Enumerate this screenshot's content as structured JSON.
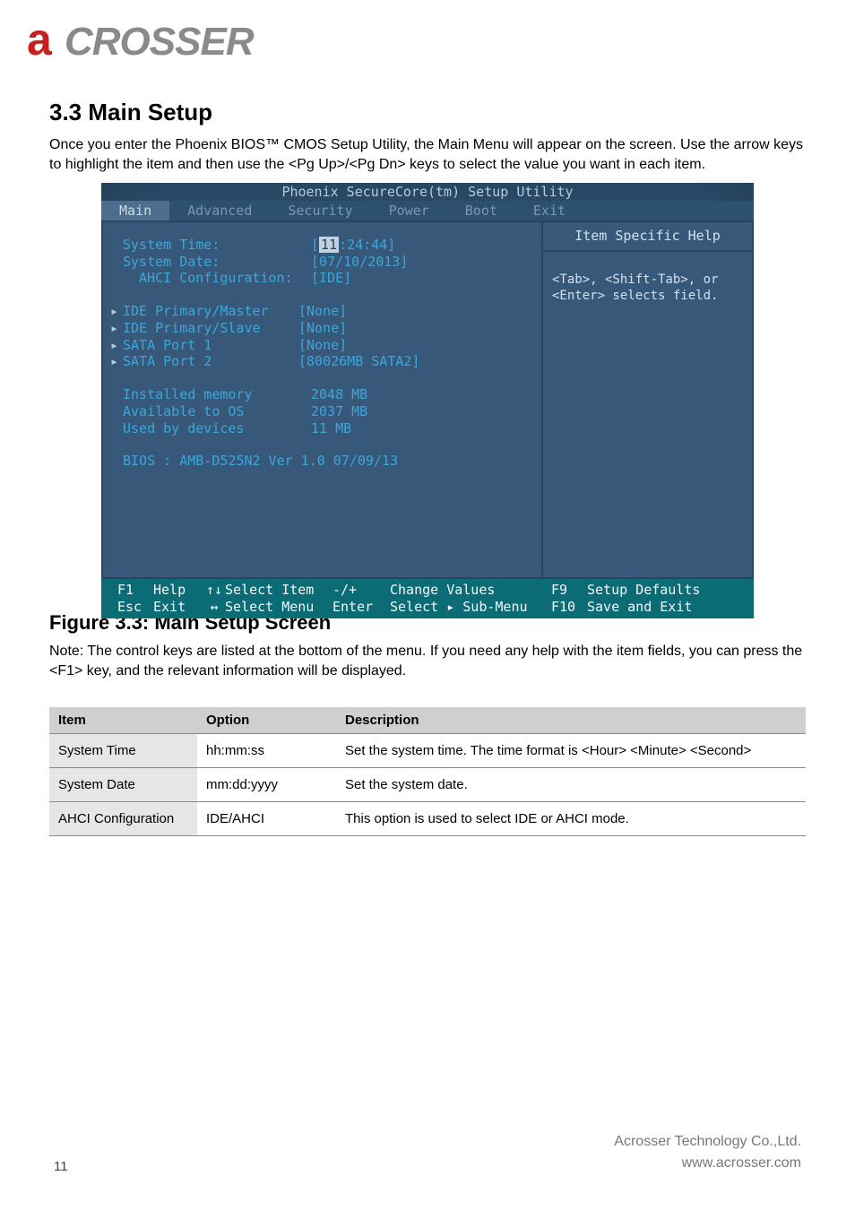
{
  "logo": {
    "first": "a",
    "rest": "CROSSER",
    "shadow": ""
  },
  "doc": {
    "h1": "3.3 Main Setup",
    "p1": "Once you enter the Phoenix BIOS™ CMOS Setup Utility, the Main Menu will appear on the screen. Use the arrow keys to highlight the item and then use the <Pg Up>/<Pg Dn> keys to select the value you want in each item.",
    "fig": "Figure 3.3: Main Setup Screen",
    "note": "Note: The control keys are listed at the bottom of the menu. If you need any help with the item fields, you can press the <F1> key, and the relevant information will be displayed.",
    "table": {
      "headers": [
        "Item",
        "Option",
        "Description"
      ],
      "rows": [
        {
          "c1": "System Time",
          "c2": "hh:mm:ss",
          "c3": "Set the system time. The time format is <Hour> <Minute> <Second>"
        },
        {
          "c1": "System Date",
          "c2": "mm:dd:yyyy",
          "c3": "Set the system date."
        },
        {
          "c1": "AHCI Configuration",
          "c2": "IDE/AHCI",
          "c3": "This option is used to select IDE or AHCI mode."
        }
      ]
    }
  },
  "bios": {
    "title": "Phoenix SecureCore(tm) Setup Utility",
    "tabs": [
      "Main",
      "Advanced",
      "Security",
      "Power",
      "Boot",
      "Exit"
    ],
    "activeTab": "Main",
    "fields": {
      "systemTimeLabel": "System Time:",
      "systemTimeVal": {
        "hh": "11",
        "rest": ":24:44"
      },
      "systemDateLabel": "System Date:",
      "systemDateVal": "[07/10/2013]",
      "ahciLabel": "AHCI Configuration:",
      "ahciVal": "[IDE]",
      "idePriMasterLabel": "IDE Primary/Master",
      "idePriMasterVal": "[None]",
      "idePriSlaveLabel": "IDE Primary/Slave",
      "idePriSlaveVal": "[None]",
      "sata1Label": "SATA Port 1",
      "sata1Val": "[None]",
      "sata2Label": "SATA Port 2",
      "sata2Val": "[80026MB SATA2]",
      "instMemLabel": "Installed memory",
      "instMemVal": "2048 MB",
      "availOSLabel": "Available to OS",
      "availOSVal": "2037 MB",
      "usedDevLabel": "Used by devices",
      "usedDevVal": "11 MB",
      "biosLine": "BIOS : AMB-D525N2  Ver 1.0  07/09/13"
    },
    "help": {
      "title": "Item Specific Help",
      "body": "<Tab>, <Shift-Tab>, or <Enter> selects field."
    },
    "footer": {
      "f1": "F1",
      "help": "Help",
      "upDown": "↑↓",
      "selItem": "Select Item",
      "pm": "-/+",
      "chVal": "Change Values",
      "f9": "F9",
      "setDef": "Setup Defaults",
      "esc": "Esc",
      "exit": "Exit",
      "lr": "↔",
      "selMenu": "Select Menu",
      "enter": "Enter",
      "selSub": "Select ▸ Sub-Menu",
      "f10": "F10",
      "save": "Save and Exit"
    }
  },
  "footer": {
    "line1": "Acrosser Technology Co.,Ltd.",
    "line2": "www.acrosser.com"
  },
  "pagenum": "11"
}
